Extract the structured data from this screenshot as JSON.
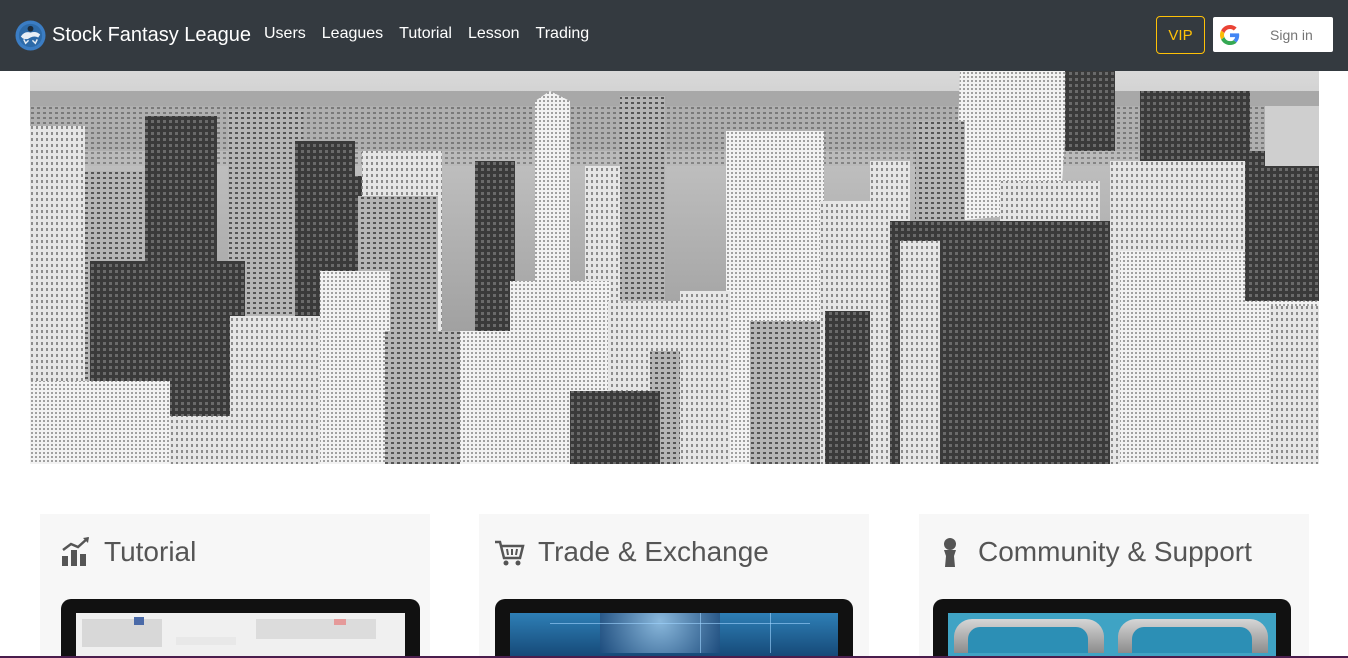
{
  "navbar": {
    "brand": "Stock Fantasy League",
    "logo_icon": "bull-logo-icon",
    "links": [
      "Users",
      "Leagues",
      "Tutorial",
      "Lesson",
      "Trading"
    ],
    "vip_label": "VIP",
    "signin_label": "Sign in",
    "signin_icon": "google-icon",
    "bg_color": "#343a40",
    "vip_color": "#ffc107"
  },
  "hero": {
    "image": "city-skyline-grayscale"
  },
  "cards": [
    {
      "title": "Tutorial",
      "icon": "chart-bars-icon"
    },
    {
      "title": "Trade & Exchange",
      "icon": "shopping-cart-icon"
    },
    {
      "title": "Community & Support",
      "icon": "person-icon"
    }
  ]
}
